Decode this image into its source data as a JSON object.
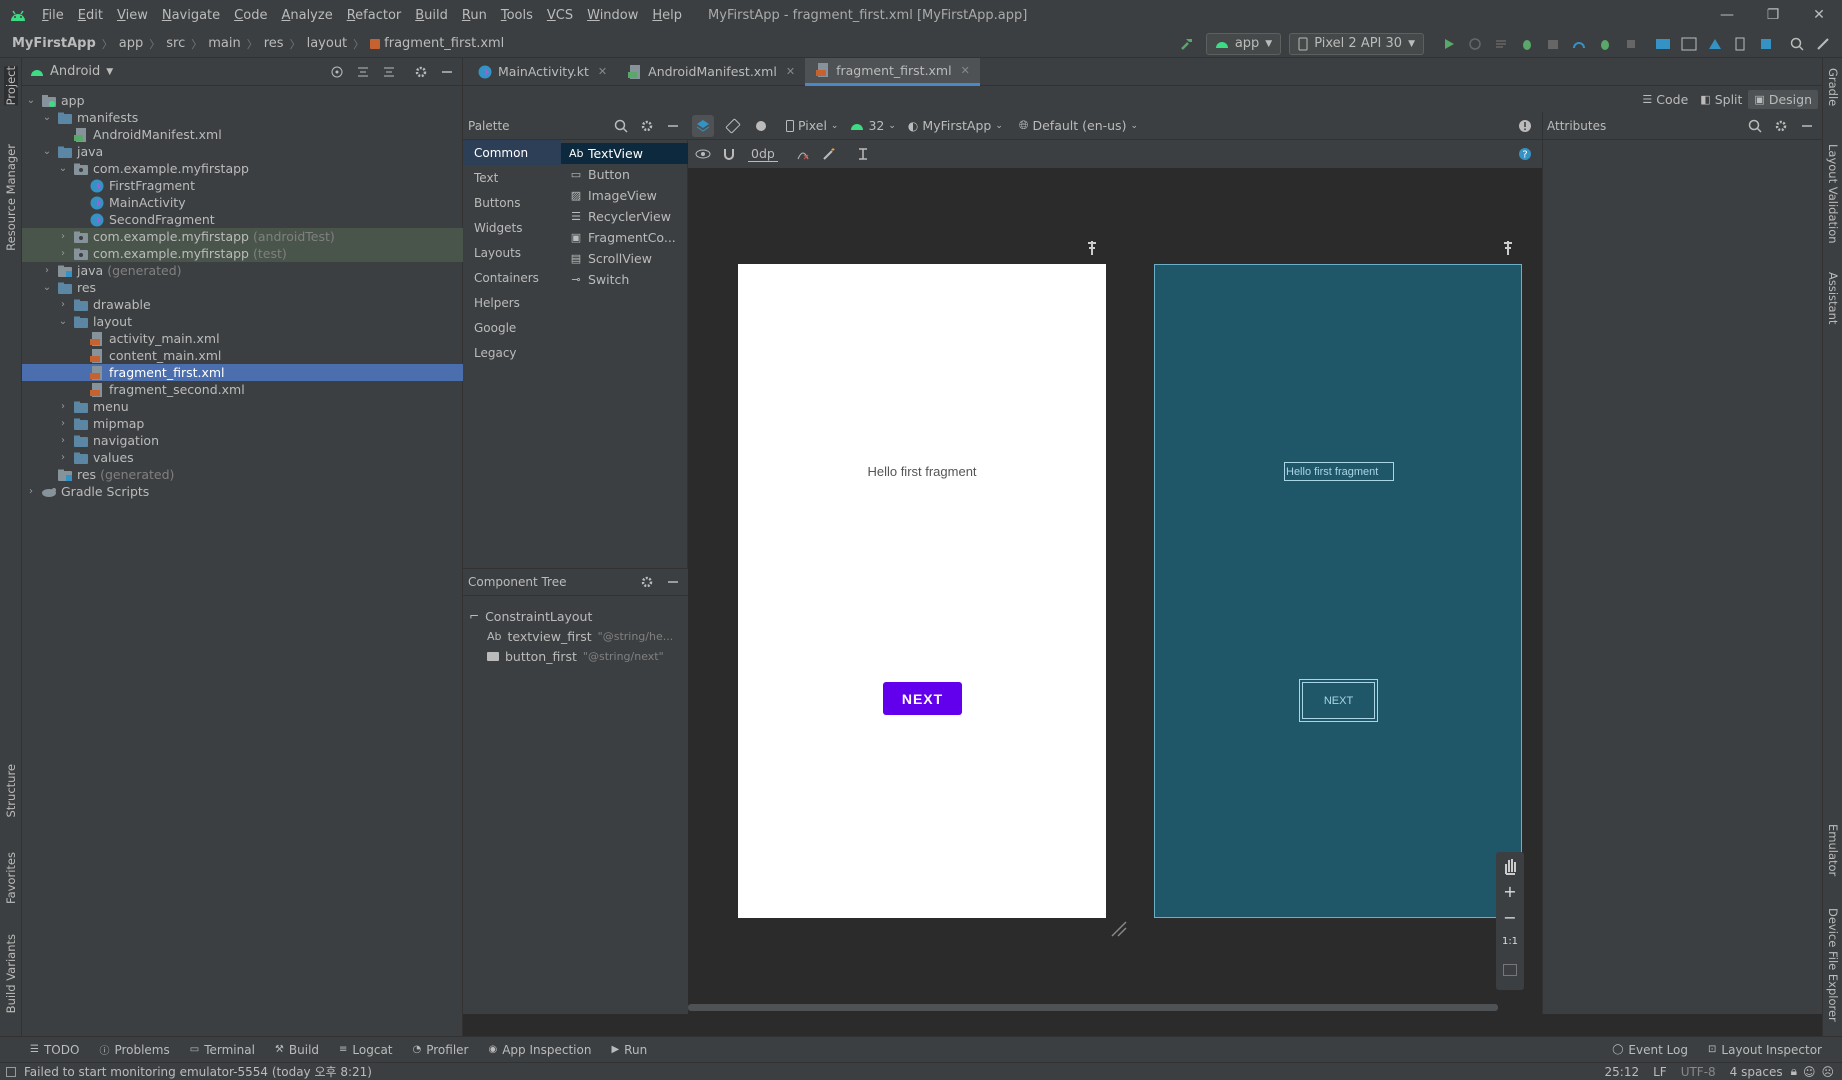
{
  "window": {
    "title": "MyFirstApp - fragment_first.xml [MyFirstApp.app]",
    "menu": [
      "File",
      "Edit",
      "View",
      "Navigate",
      "Code",
      "Analyze",
      "Refactor",
      "Build",
      "Run",
      "Tools",
      "VCS",
      "Window",
      "Help"
    ],
    "controls": {
      "minimize": "—",
      "maximize": "❐",
      "close": "✕"
    }
  },
  "breadcrumb": [
    "MyFirstApp",
    "app",
    "src",
    "main",
    "res",
    "layout",
    "fragment_first.xml"
  ],
  "toolbar": {
    "run_config": "app",
    "device": "Pixel 2 API 30"
  },
  "left_stripe": [
    "Project",
    "Resource Manager",
    "Structure",
    "Favorites",
    "Build Variants"
  ],
  "right_stripe": [
    "Gradle",
    "Layout Validation",
    "Assistant",
    "Emulator",
    "Device File Explorer"
  ],
  "project": {
    "view_mode": "Android",
    "tree": [
      {
        "label": "app",
        "level": 0,
        "expanded": true,
        "icon": "folder-app"
      },
      {
        "label": "manifests",
        "level": 1,
        "expanded": true,
        "icon": "folder"
      },
      {
        "label": "AndroidManifest.xml",
        "level": 2,
        "icon": "manifest-file"
      },
      {
        "label": "java",
        "level": 1,
        "expanded": true,
        "icon": "folder"
      },
      {
        "label": "com.example.myfirstapp",
        "level": 2,
        "expanded": true,
        "icon": "package"
      },
      {
        "label": "FirstFragment",
        "level": 3,
        "icon": "kotlin-class"
      },
      {
        "label": "MainActivity",
        "level": 3,
        "icon": "kotlin-class"
      },
      {
        "label": "SecondFragment",
        "level": 3,
        "icon": "kotlin-class"
      },
      {
        "label": "com.example.myfirstapp",
        "suffix": "(androidTest)",
        "level": 2,
        "expanded": false,
        "icon": "package",
        "test": true
      },
      {
        "label": "com.example.myfirstapp",
        "suffix": "(test)",
        "level": 2,
        "expanded": false,
        "icon": "package",
        "test": true
      },
      {
        "label": "java",
        "suffix": "(generated)",
        "level": 1,
        "expanded": false,
        "icon": "folder-gen"
      },
      {
        "label": "res",
        "level": 1,
        "expanded": true,
        "icon": "folder"
      },
      {
        "label": "drawable",
        "level": 2,
        "expanded": false,
        "icon": "folder"
      },
      {
        "label": "layout",
        "level": 2,
        "expanded": true,
        "icon": "folder"
      },
      {
        "label": "activity_main.xml",
        "level": 3,
        "icon": "layout-file"
      },
      {
        "label": "content_main.xml",
        "level": 3,
        "icon": "layout-file"
      },
      {
        "label": "fragment_first.xml",
        "level": 3,
        "icon": "layout-file",
        "selected": true
      },
      {
        "label": "fragment_second.xml",
        "level": 3,
        "icon": "layout-file"
      },
      {
        "label": "menu",
        "level": 2,
        "expanded": false,
        "icon": "folder"
      },
      {
        "label": "mipmap",
        "level": 2,
        "expanded": false,
        "icon": "folder"
      },
      {
        "label": "navigation",
        "level": 2,
        "expanded": false,
        "icon": "folder"
      },
      {
        "label": "values",
        "level": 2,
        "expanded": false,
        "icon": "folder"
      },
      {
        "label": "res",
        "suffix": "(generated)",
        "level": 1,
        "icon": "folder-gen"
      },
      {
        "label": "Gradle Scripts",
        "level": 0,
        "expanded": false,
        "icon": "gradle"
      }
    ]
  },
  "tabs": [
    {
      "label": "MainActivity.kt",
      "icon": "kotlin-class",
      "active": false
    },
    {
      "label": "AndroidManifest.xml",
      "icon": "manifest-file",
      "active": false
    },
    {
      "label": "fragment_first.xml",
      "icon": "layout-file",
      "active": true
    }
  ],
  "modes": [
    "Code",
    "Split",
    "Design"
  ],
  "palette": {
    "title": "Palette",
    "categories": [
      "Common",
      "Text",
      "Buttons",
      "Widgets",
      "Layouts",
      "Containers",
      "Helpers",
      "Google",
      "Legacy"
    ],
    "items": [
      "TextView",
      "Button",
      "ImageView",
      "RecyclerView",
      "FragmentCo...",
      "ScrollView",
      "Switch"
    ]
  },
  "design_toolbar": {
    "device": "Pixel",
    "api": "32",
    "theme": "MyFirstApp",
    "locale": "Default (en-us)",
    "margin": "0dp"
  },
  "component_tree": {
    "title": "Component Tree",
    "root": "ConstraintLayout",
    "children": [
      {
        "prefix": "Ab",
        "id": "textview_first",
        "value": "\"@string/he..."
      },
      {
        "prefix": "",
        "id": "button_first",
        "value": "\"@string/next\""
      }
    ]
  },
  "preview": {
    "hello_text": "Hello first fragment",
    "button_text": "NEXT",
    "blueprint_button_text": "NEXT",
    "button_color": "#6200ee"
  },
  "zoom_controls": {
    "plus": "+",
    "minus": "−",
    "ratio": "1:1"
  },
  "attributes": {
    "title": "Attributes"
  },
  "bottom_tools": [
    "TODO",
    "Problems",
    "Terminal",
    "Build",
    "Logcat",
    "Profiler",
    "App Inspection",
    "Run"
  ],
  "bottom_tools_right": [
    "Event Log",
    "Layout Inspector"
  ],
  "status": {
    "message": "Failed to start monitoring emulator-5554 (today 오후 8:21)",
    "position": "25:12",
    "line_sep": "LF",
    "encoding": "UTF-8",
    "indent": "4 spaces"
  }
}
